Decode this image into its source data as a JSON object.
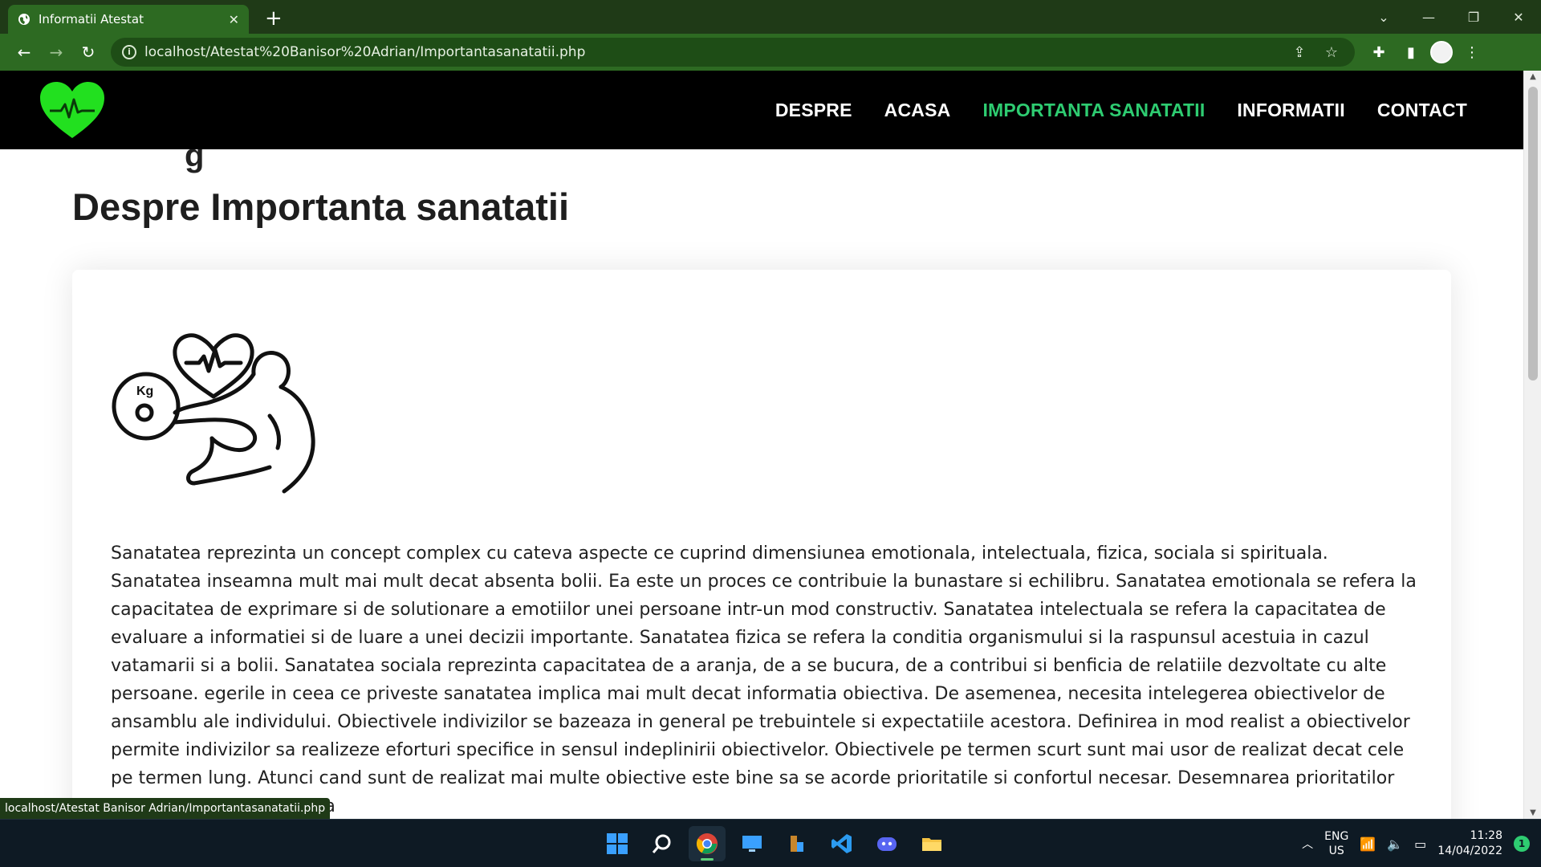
{
  "browser": {
    "tab_title": "Informatii Atestat",
    "tab_close": "✕",
    "new_tab": "+",
    "url": "localhost/Atestat%20Banisor%20Adrian/Importantasanatatii.php",
    "status_url": "localhost/Atestat Banisor Adrian/Importantasanatatii.php"
  },
  "site": {
    "nav": [
      "DESPRE",
      "ACASA",
      "IMPORTANTA SANATATII",
      "INFORMATII",
      "CONTACT"
    ],
    "active_nav": "IMPORTANTA SANATATII",
    "partial_heading": "g",
    "page_title": "Despre Importanta sanatatii",
    "illustration_label": "Kg",
    "article_text": "Sanatatea reprezinta un concept complex cu cateva aspecte ce cuprind dimensiunea emotionala, intelectuala, fizica, sociala si spirituala. Sanatatea inseamna mult mai mult decat absenta bolii. Ea este un proces ce contribuie la bunastare si echilibru. Sanatatea emotionala se refera la capacitatea de exprimare si de solutionare a emotiilor unei persoane intr-un mod constructiv. Sanatatea intelectuala se refera la capacitatea de evaluare a informatiei si de luare a unei decizii importante. Sanatatea fizica se refera la conditia organismului si la raspunsul acestuia in cazul vatamarii si a bolii. Sanatatea sociala reprezinta capacitatea de a aranja, de a se bucura, de a contribui si benficia de relatiile dezvoltate cu alte persoane. egerile in ceea ce priveste sanatatea implica mai mult decat informatia obiectiva. De asemenea, necesita intelegerea obiectivelor de ansamblu ale individului. Obiectivele indivizilor se bazeaza in general pe trebuintele si expectatiile acestora. Definirea in mod realist a obiectivelor permite indivizilor sa realizeze eforturi specifice in sensul indeplinirii obiectivelor. Obiectivele pe termen scurt sunt mai usor de realizat decat cele pe termen lung. Atunci cand sunt de realizat mai multe obiective este bine sa se acorde prioritatile si confortul necesar. Desemnarea prioritatilor poate fi realizata pe baza"
  },
  "taskbar": {
    "lang_top": "ENG",
    "lang_bottom": "US",
    "time": "11:28",
    "date": "14/04/2022",
    "notifications": "1",
    "apps": [
      "windows-start",
      "search",
      "chrome",
      "remote-desktop",
      "code-blocks",
      "vscode",
      "discord",
      "file-explorer"
    ]
  },
  "colors": {
    "tab_bar": "#1f3a17",
    "toolbar": "#2d6a22",
    "header": "#000000",
    "nav_active": "#2ecc71",
    "logo_green": "#22e01f"
  }
}
